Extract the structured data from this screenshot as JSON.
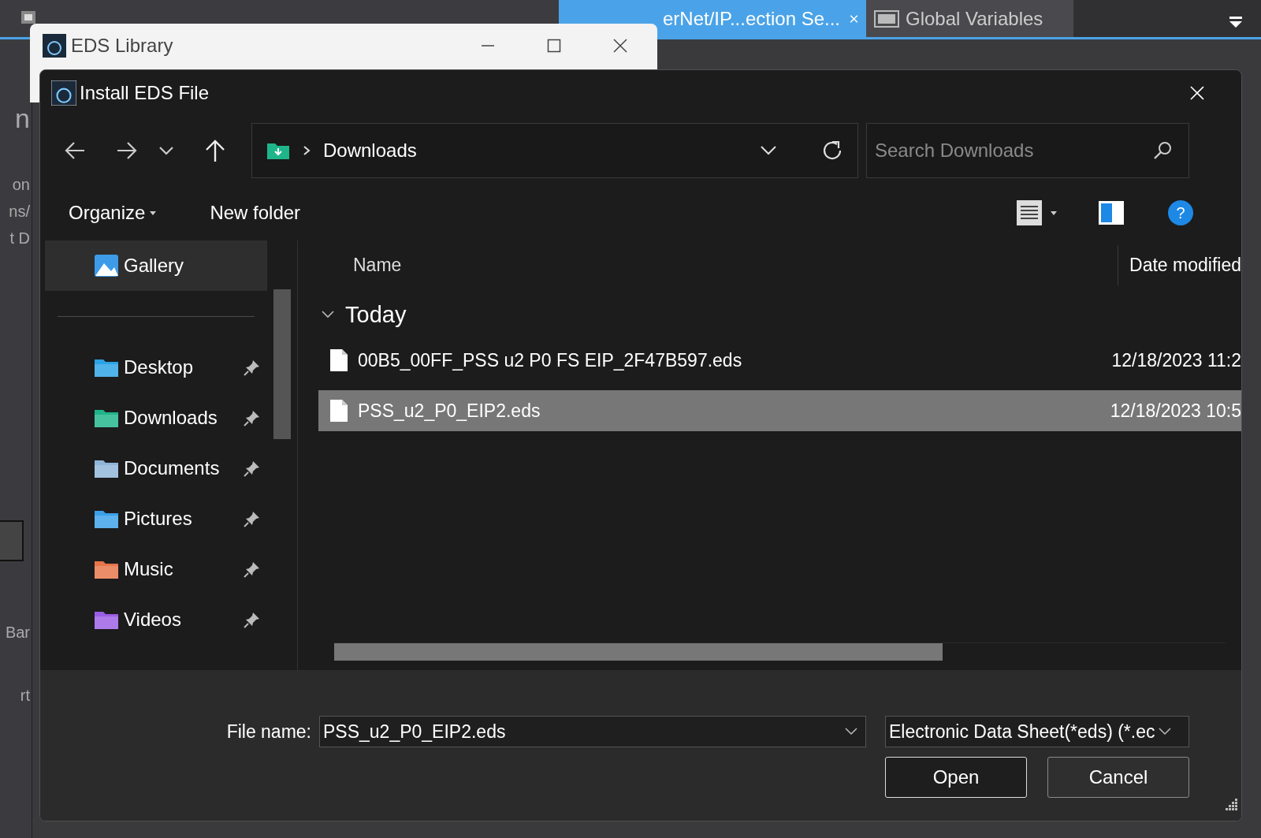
{
  "background_tabs": [
    {
      "selected": false,
      "kind": "device"
    },
    {
      "selected": false,
      "kind": "plain"
    },
    {
      "label": "erNet/IP...ection Se...",
      "selected": true,
      "kind": "plain"
    },
    {
      "label": "Global Variables",
      "selected": false,
      "kind": "var"
    }
  ],
  "background_fragments": [
    "n",
    "on",
    "ns/",
    "t D",
    "Bar",
    "rt"
  ],
  "eds_library_window": {
    "title": "EDS Library"
  },
  "dialog": {
    "title": "Install EDS File",
    "address": {
      "folder": "Downloads"
    },
    "search": {
      "placeholder": "Search Downloads"
    },
    "toolbar": {
      "organize": "Organize",
      "new_folder": "New folder",
      "help": "?"
    },
    "nav_items": [
      {
        "label": "Gallery",
        "kind": "gallery",
        "selected": true,
        "pinned": false
      },
      {
        "label": "Desktop",
        "kind": "desktop",
        "selected": false,
        "pinned": true
      },
      {
        "label": "Downloads",
        "kind": "downloads",
        "selected": false,
        "pinned": true
      },
      {
        "label": "Documents",
        "kind": "documents",
        "selected": false,
        "pinned": true
      },
      {
        "label": "Pictures",
        "kind": "pictures",
        "selected": false,
        "pinned": true
      },
      {
        "label": "Music",
        "kind": "music",
        "selected": false,
        "pinned": true
      },
      {
        "label": "Videos",
        "kind": "videos",
        "selected": false,
        "pinned": true
      }
    ],
    "columns": [
      "Name",
      "Date modified"
    ],
    "groups": [
      {
        "label": "Today",
        "expanded": true,
        "files": [
          {
            "name": "00B5_00FF_PSS u2 P0 FS EIP_2F47B597.eds",
            "date": "12/18/2023 11:2",
            "selected": false
          },
          {
            "name": "PSS_u2_P0_EIP2.eds",
            "date": "12/18/2023 10:5",
            "selected": true
          }
        ]
      }
    ],
    "file_name": {
      "label": "File name:",
      "value": "PSS_u2_P0_EIP2.eds"
    },
    "file_type": "Electronic Data Sheet(*eds) (*.ec",
    "buttons": [
      {
        "label": "Open",
        "kind": "primary"
      },
      {
        "label": "Cancel",
        "kind": "secondary"
      }
    ]
  }
}
